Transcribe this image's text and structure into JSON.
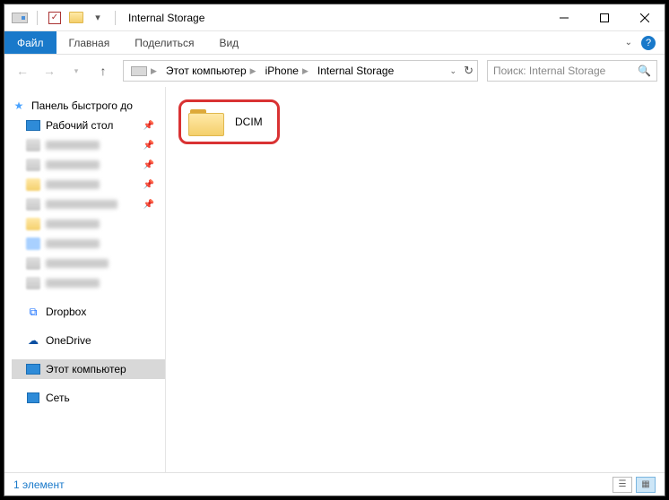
{
  "title": "Internal Storage",
  "ribbon": {
    "file": "Файл",
    "home": "Главная",
    "share": "Поделиться",
    "view": "Вид"
  },
  "breadcrumb": {
    "items": [
      "Этот компьютер",
      "iPhone",
      "Internal Storage"
    ]
  },
  "search": {
    "placeholder": "Поиск: Internal Storage"
  },
  "sidebar": {
    "quick_access": "Панель быстрого до",
    "desktop": "Рабочий стол",
    "dropbox": "Dropbox",
    "onedrive": "OneDrive",
    "this_pc": "Этот компьютер",
    "network": "Сеть"
  },
  "content": {
    "folder": "DCIM"
  },
  "status": {
    "count": "1 элемент"
  }
}
